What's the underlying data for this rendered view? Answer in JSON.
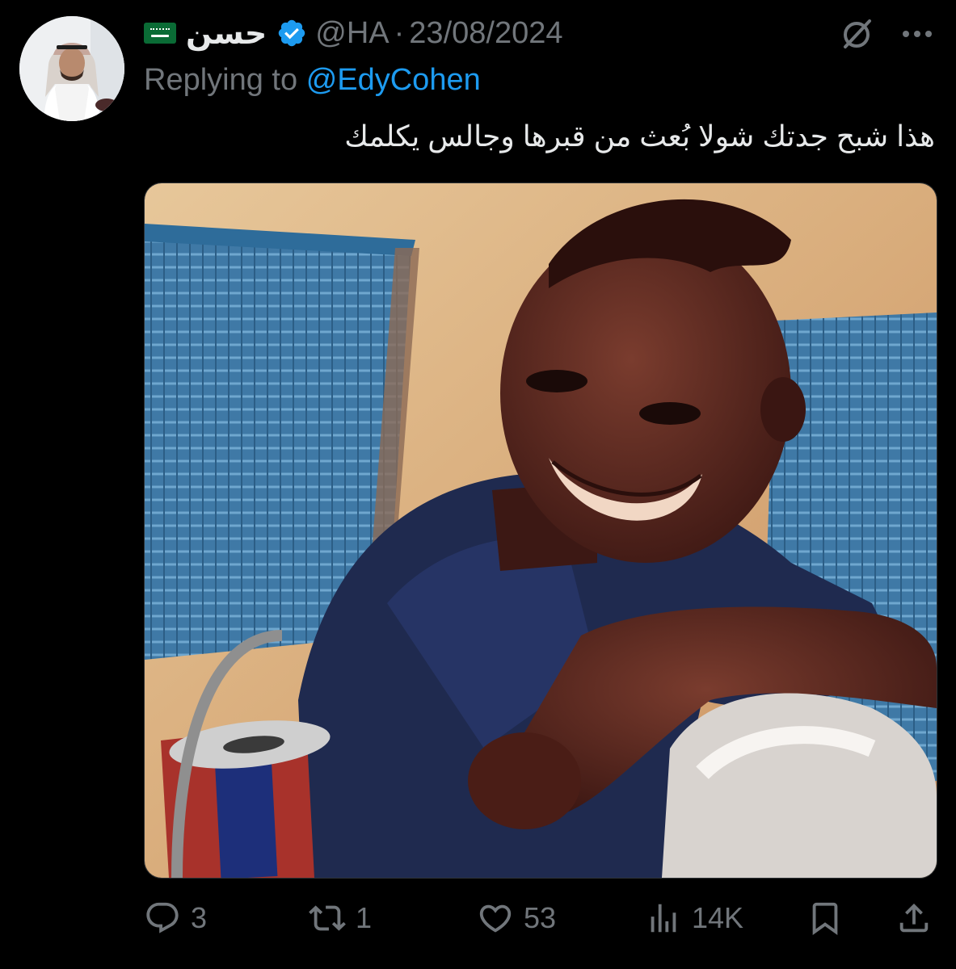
{
  "tweet": {
    "display_name": "حسن",
    "handle": "@HA",
    "separator": "·",
    "date": "23/08/2024",
    "replying_prefix": "Replying to",
    "replying_to": "@EdyCohen",
    "text": "هذا شبح جدتك شولا بُعث من قبرها وجالس يكلمك",
    "verified": true,
    "icons": {
      "flag": "saudi-flag-emoji",
      "verified": "verified-badge-icon",
      "grok": "grok-icon",
      "more": "more-icon"
    }
  },
  "actions": {
    "replies": "3",
    "reposts": "1",
    "likes": "53",
    "views": "14K"
  },
  "colors": {
    "background": "#000000",
    "text": "#e7e9ea",
    "secondary": "#71767b",
    "link": "#1d9bf0",
    "verified": "#1d9bf0"
  }
}
